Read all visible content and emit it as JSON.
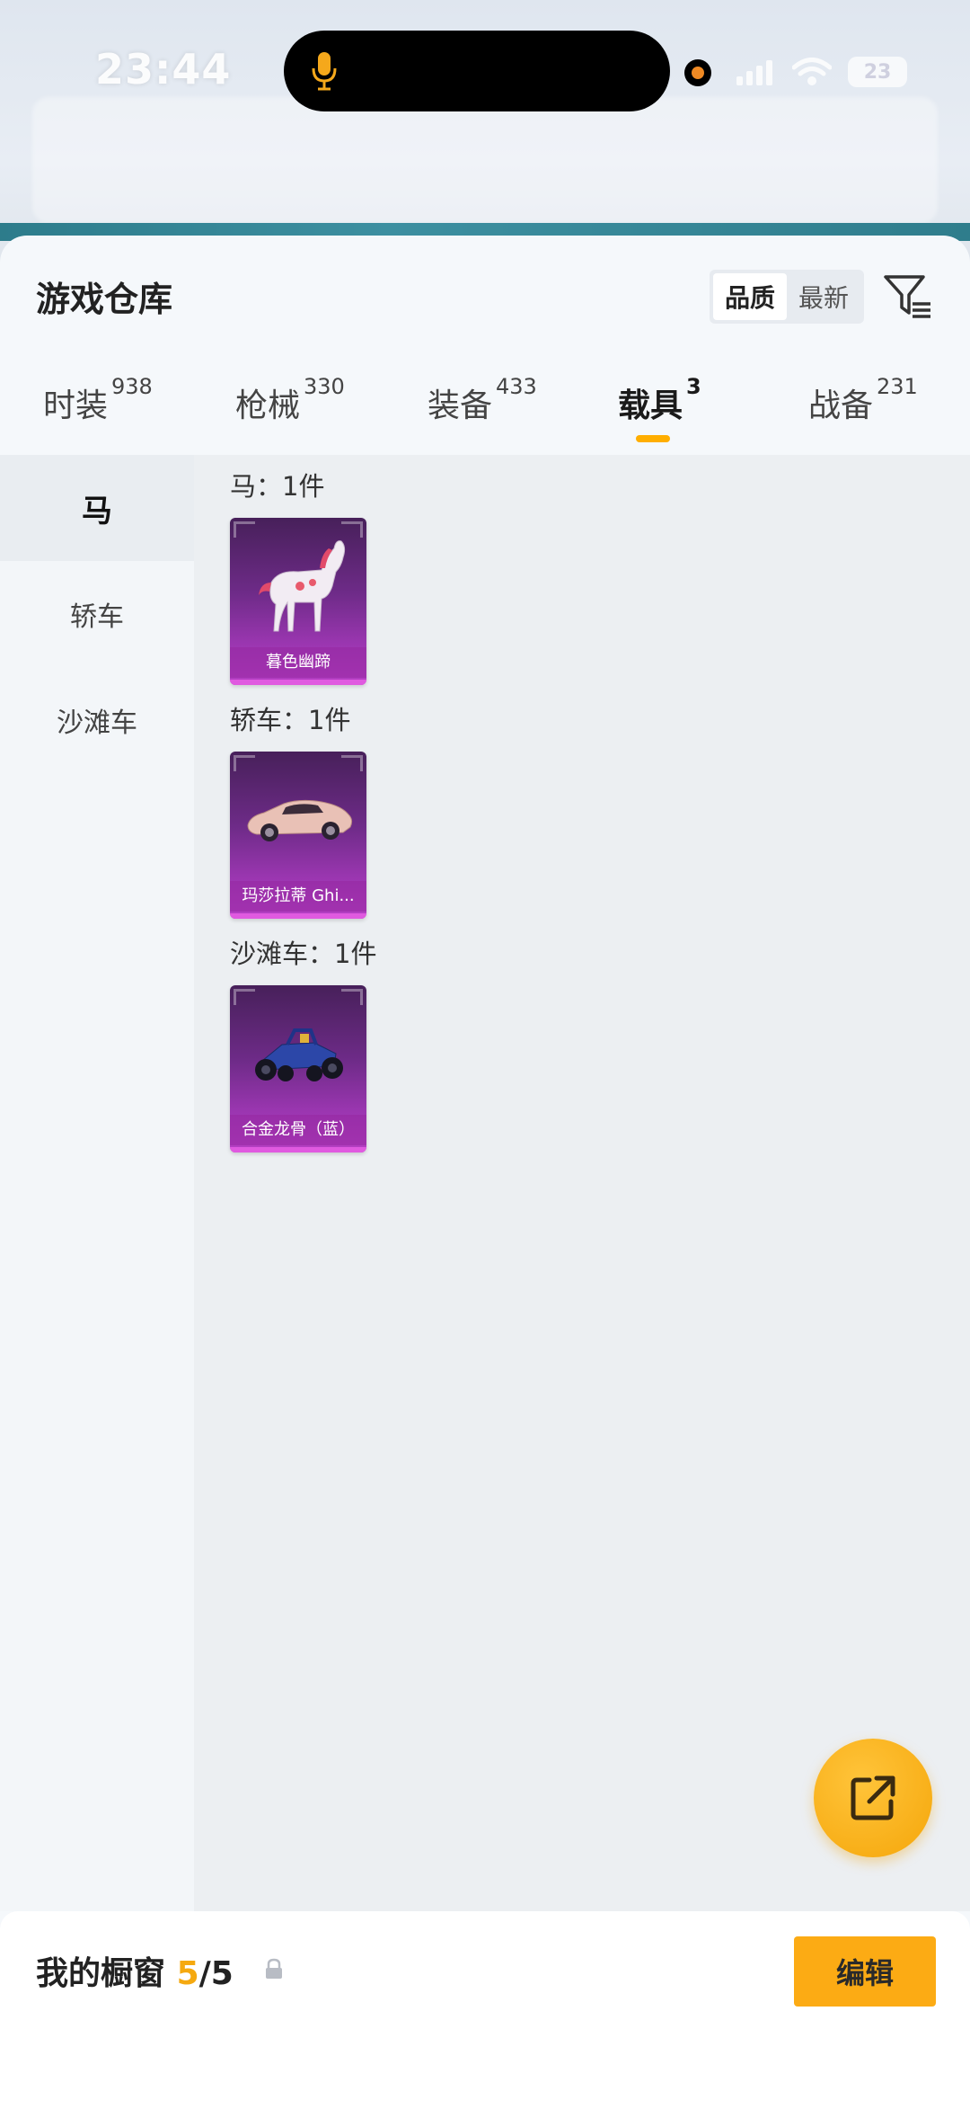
{
  "status_bar": {
    "time": "23:44",
    "battery": "23"
  },
  "sheet": {
    "title": "游戏仓库",
    "sort": {
      "options": [
        "品质",
        "最新"
      ],
      "active": 0
    }
  },
  "tabs": [
    {
      "label": "时装",
      "count": "938"
    },
    {
      "label": "枪械",
      "count": "330"
    },
    {
      "label": "装备",
      "count": "433"
    },
    {
      "label": "载具",
      "count": "3"
    },
    {
      "label": "战备",
      "count": "231"
    }
  ],
  "side_nav": [
    {
      "label": "马"
    },
    {
      "label": "轿车"
    },
    {
      "label": "沙滩车"
    }
  ],
  "groups": [
    {
      "title": "马：1件",
      "item": {
        "name": "暮色幽蹄",
        "icon": "horse-icon"
      }
    },
    {
      "title": "轿车：1件",
      "item": {
        "name": "玛莎拉蒂 Ghi...",
        "icon": "car-icon"
      }
    },
    {
      "title": "沙滩车：1件",
      "item": {
        "name": "合金龙骨（蓝）",
        "icon": "buggy-icon"
      }
    }
  ],
  "showcase": {
    "label": "我的橱窗",
    "current": "5",
    "separator_total": "/5",
    "edit_label": "编辑"
  },
  "colors": {
    "accent": "#fcab14",
    "tab_indicator": "#ffae00",
    "card_purple": "#9a36b0"
  }
}
